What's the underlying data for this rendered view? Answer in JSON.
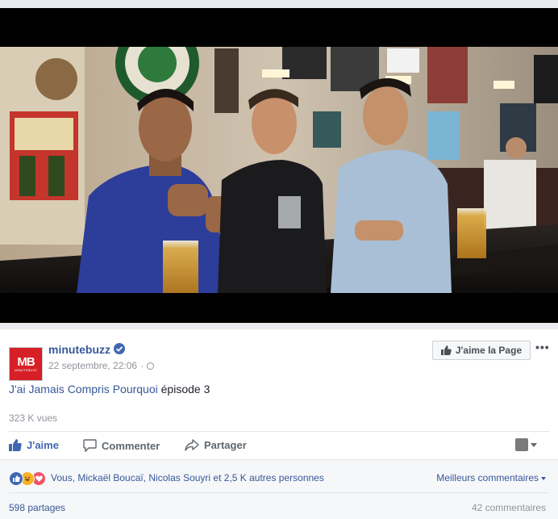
{
  "video": {
    "scene_alt": "Scène de bar avec quatre personnes"
  },
  "post": {
    "page_name": "minutebuzz",
    "logo_text": "MB",
    "logo_subtext": "MINUTEBUZZ",
    "date": "22 septembre, 22:06",
    "meta_separator": "·",
    "like_page_label": "J'aime la Page",
    "more_label": "•••",
    "text_link": "J'ai Jamais Compris Pourquoi",
    "text_rest": " épisode 3",
    "views": "323 K vues"
  },
  "actions": {
    "like": "J'aime",
    "comment": "Commenter",
    "share": "Partager"
  },
  "reactions": {
    "summary": "Vous, Mickaël Boucaï, Nicolas Souyri et 2,5 K autres personnes",
    "sort_label": "Meilleurs commentaires",
    "types": [
      "like",
      "haha",
      "love"
    ]
  },
  "counts": {
    "shares": "598 partages",
    "comments": "42 commentaires"
  },
  "colors": {
    "facebook_blue": "#4267b2",
    "link": "#365899",
    "logo_red": "#d61f26"
  }
}
